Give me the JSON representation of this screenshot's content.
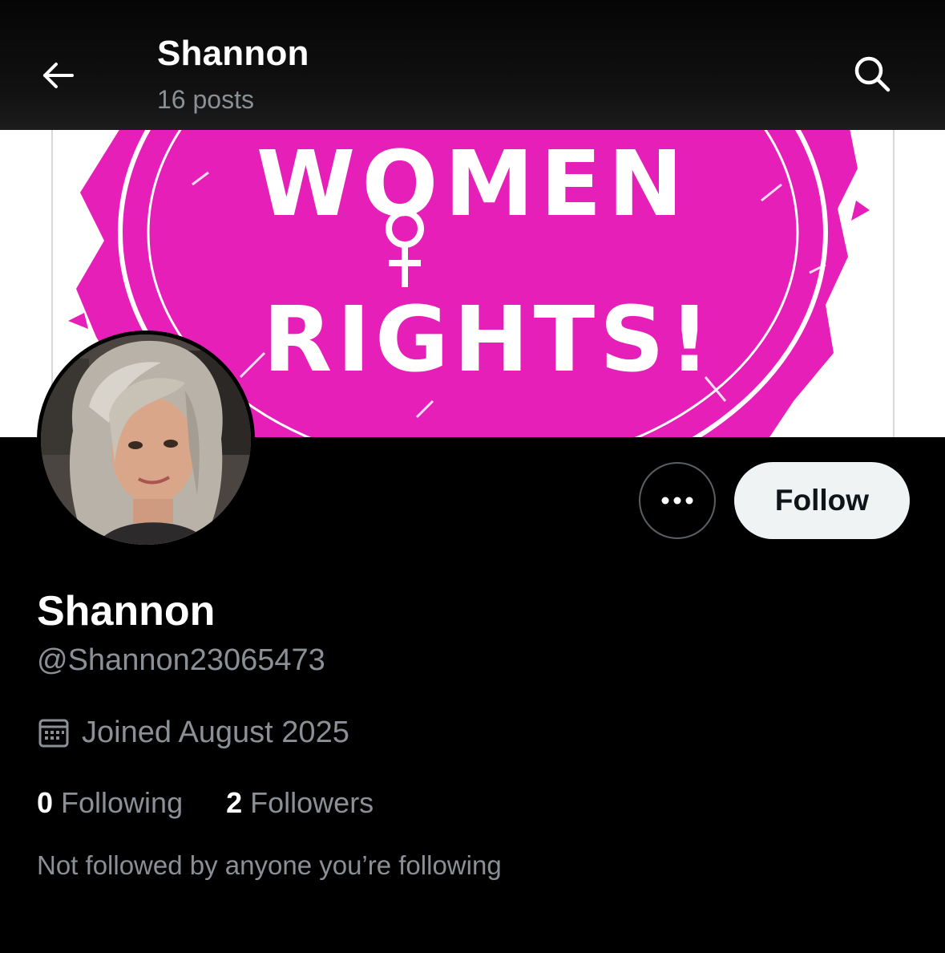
{
  "header": {
    "title": "Shannon",
    "subtitle": "16 posts",
    "back_icon": "arrow-left-icon",
    "search_icon": "search-icon"
  },
  "banner": {
    "line1": "WOMEN",
    "line2": "RIGHTS!",
    "accent_color": "#e61fb8",
    "symbol_icon": "female-symbol-icon"
  },
  "actions": {
    "more_icon": "more-horizontal-icon",
    "follow_label": "Follow"
  },
  "profile": {
    "display_name": "Shannon",
    "handle": "@Shannon23065473",
    "joined_icon": "calendar-icon",
    "joined": "Joined August 2025",
    "following_count": "0",
    "following_label": "Following",
    "followers_count": "2",
    "followers_label": "Followers",
    "mutual_text": "Not followed by anyone you’re following"
  },
  "colors": {
    "background": "#000000",
    "primary_text": "#ffffff",
    "secondary_text": "#8b9096",
    "follow_button_bg": "#eff3f4"
  }
}
